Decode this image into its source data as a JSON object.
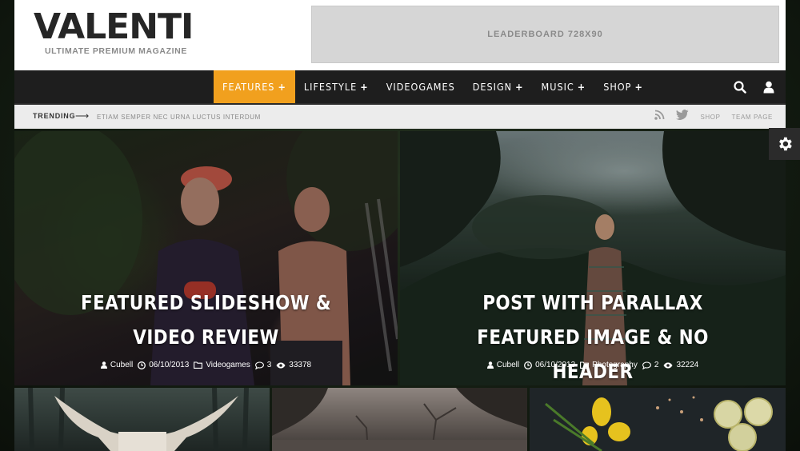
{
  "header": {
    "logo_title": "VALENTI",
    "logo_tagline": "ULTIMATE PREMIUM MAGAZINE",
    "leaderboard_label": "LEADERBOARD 728X90"
  },
  "nav": {
    "items": [
      {
        "label": "FEATURES",
        "has_plus": true,
        "active": true
      },
      {
        "label": "LIFESTYLE",
        "has_plus": true,
        "active": false
      },
      {
        "label": "VIDEOGAMES",
        "has_plus": false,
        "active": false
      },
      {
        "label": "DESIGN",
        "has_plus": true,
        "active": false
      },
      {
        "label": "MUSIC",
        "has_plus": true,
        "active": false
      },
      {
        "label": "SHOP",
        "has_plus": true,
        "active": false
      }
    ],
    "plus": "+",
    "icons": [
      "search-icon",
      "user-icon"
    ],
    "accent_color": "#f1a01e"
  },
  "trending": {
    "label": "TRENDING",
    "arrow": "⟶",
    "headline": "ETIAM SEMPER NEC URNA LUCTUS INTERDUM",
    "right_links": [
      "SHOP",
      "TEAM PAGE"
    ],
    "icons": [
      "rss-icon",
      "twitter-icon"
    ]
  },
  "featured": [
    {
      "title": "FEATURED SLIDESHOW & VIDEO REVIEW",
      "author": "Cubell",
      "date": "06/10/2013",
      "category": "Videogames",
      "comments": "3",
      "views": "33378"
    },
    {
      "title": "POST WITH PARALLAX FEATURED IMAGE & NO HEADER",
      "author": "Cubell",
      "date": "06/10/2013",
      "category": "Photography",
      "comments": "2",
      "views": "32224"
    }
  ],
  "settings_icon": "gear-icon"
}
